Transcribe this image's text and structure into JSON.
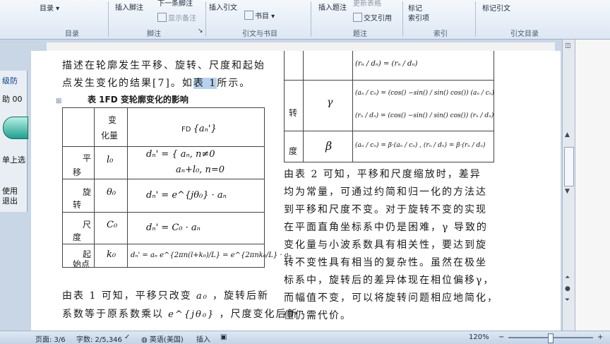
{
  "ribbon": {
    "catalog_label": "目录",
    "insert_footnote": "插入脚注",
    "next_footnote": "下一条脚注",
    "show_notes": "显示备注",
    "insert_citation": "插入引文",
    "bibliography": "书目",
    "insert_caption": "插入题注",
    "update_table": "更新表格",
    "cross_reference": "交叉引用",
    "mark_entry": "标记",
    "index_entry": "索引项",
    "mark_citation": "标记引文",
    "groups": {
      "toc": "目录",
      "footnotes": "脚注",
      "citations": "引文与书目",
      "captions": "题注",
      "index": "索引",
      "toa": "引文目录"
    }
  },
  "left_window": {
    "line1": "级防",
    "line2": "助 00",
    "line3": "单上选",
    "line4": "使用",
    "line5": "退出"
  },
  "document": {
    "para1_line1": "描述在轮廓发生平移、旋转、尺度和起始",
    "para1_line2_a": "点发生变化的结果[7]。如",
    "para1_line2_sel": "表 1",
    "para1_line2_b": "所示。",
    "table1_caption": "表 1FD 变轮廓变化的影响",
    "table1": {
      "header_change": "变",
      "header_qty": "化量",
      "header_fd": "FD",
      "rows": [
        {
          "t1": "平",
          "t2": "移",
          "var": "l₀",
          "formula_a": "dₙ' = { aₙ,  n≠0",
          "formula_b": "aₙ+l₀,  n=0"
        },
        {
          "t1": "旋",
          "t2": "转",
          "var": "θ₀",
          "formula_a": "dₙ' = e^{jθ₀} · aₙ",
          "formula_b": ""
        },
        {
          "t1": "尺",
          "t2": "度",
          "var": "C₀",
          "formula_a": "dₙ' = C₀ · aₙ",
          "formula_b": ""
        },
        {
          "t1": "起",
          "t2": "始点",
          "var": "k₀",
          "formula_a": "dₙ' = aₙ e^{2πn(l+k₀)/L} = e^{2πnk₀/L} · aₙ",
          "formula_b": ""
        }
      ]
    },
    "para2_line1": "由表 1 可知，平移只改变",
    "para2_line1_b": "，旋转后新",
    "para2_line2": "系数等于原系数乘以",
    "para2_line2_b": "，尺度变化后新",
    "table2": {
      "row_rotate": "转",
      "row_scale": "度",
      "sym_gamma": "γ",
      "sym_beta": "β",
      "f_top": "(rₙ / dₙ) = (rₙ / dₙ)",
      "f_gamma_a": "(aₙ / cₙ) = (cos() −sin() / sin() cos()) (aₙ / cₙ)",
      "f_gamma_b": "(rₙ / dₙ) = (cos() −sin() / sin() cos()) (rₙ / dₙ)",
      "f_beta": "(aₙ / cₙ) = β·(aₙ / cₙ) ,  (rₙ / dₙ) = β·(rₙ / dₙ)"
    },
    "right_lines": [
      "由表 2 可知，平移和尺度缩放时，差异",
      "均为常量，可通过约简和归一化的方法达",
      "到平移和尺度不变。对于旋转不变的实现",
      "在平面直角坐标系中仍是困难，γ 导致的",
      "变化量与小波系数具有相关性，要达到旋",
      "转不变性具有相当的复杂性。虽然在极坐",
      "标系中，旋转后的差异体现在相位偏移γ，",
      "而幅值不变，可以将旋转问题相应地简化，",
      "但仍需代价。"
    ]
  },
  "status": {
    "page": "页面: 3/6",
    "words": "字数: 2/5,346",
    "language": "英语(美国)",
    "mode": "插入",
    "zoom": "120%"
  }
}
